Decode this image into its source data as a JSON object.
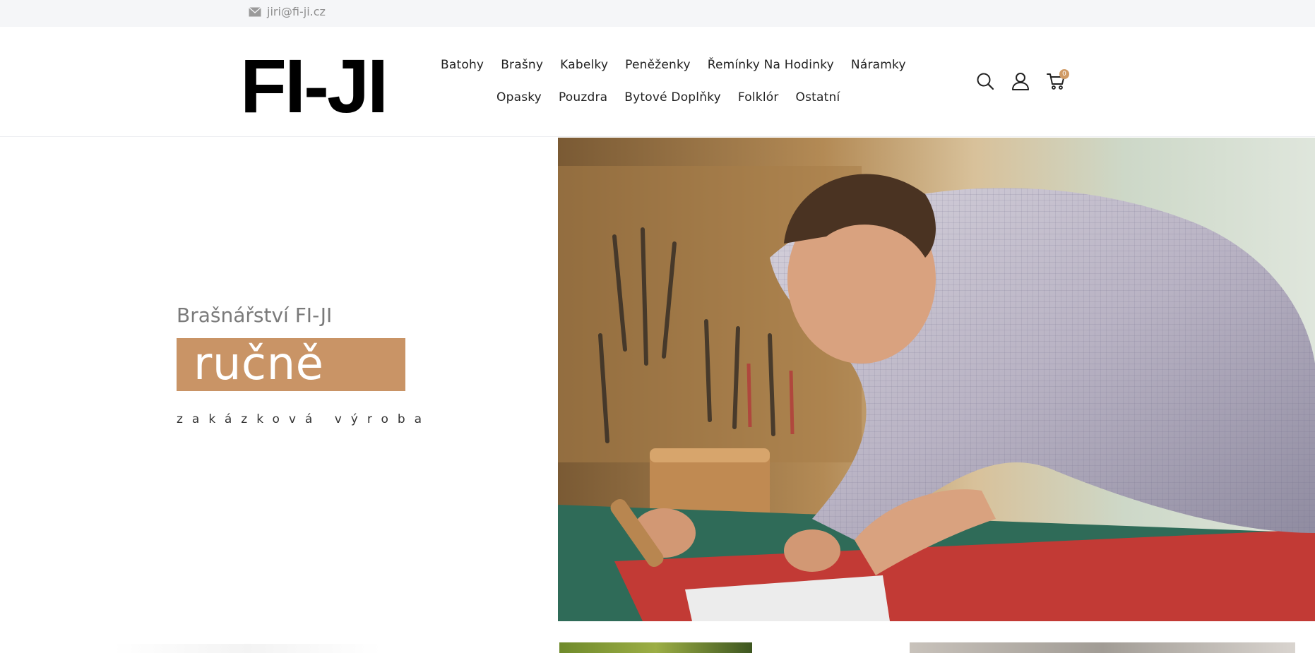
{
  "topbar": {
    "email": "jiri@fi-ji.cz",
    "icon": "mail-icon"
  },
  "header": {
    "logo": "FI-JI",
    "nav_row1": [
      "Batohy",
      "Brašny",
      "Kabelky",
      "Peněženky",
      "Řemínky Na Hodinky",
      "Náramky"
    ],
    "nav_row2": [
      "Opasky",
      "Pouzdra",
      "Bytové Doplňky",
      "Folklór",
      "Ostatní"
    ],
    "icons": [
      "search-icon",
      "user-icon",
      "cart-icon"
    ],
    "cart_count": "0"
  },
  "hero": {
    "subtitle": "Brašnářství FI-JI",
    "badge": "ručně šitá",
    "tagline": "zakázková výroba"
  },
  "colors": {
    "accent": "#c99466",
    "topbar_bg": "#f5f6f8",
    "cart_badge": "#d09a64"
  }
}
